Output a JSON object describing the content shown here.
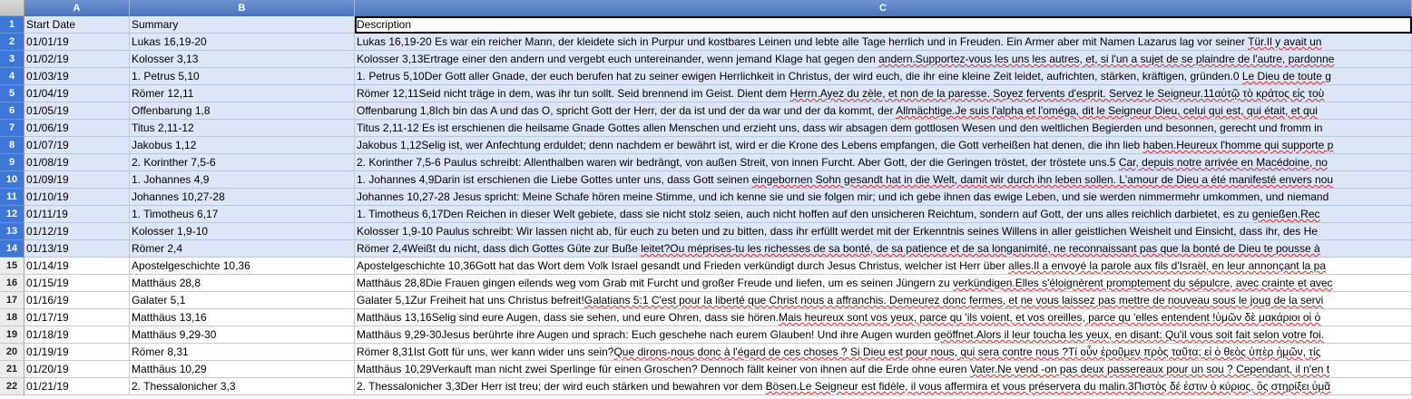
{
  "columns": [
    {
      "letter": "A"
    },
    {
      "letter": "B"
    },
    {
      "letter": "C"
    }
  ],
  "rows": [
    {
      "num": "1",
      "a": "Start Date",
      "b": "Summary",
      "c": "Description",
      "c_extra": ""
    },
    {
      "num": "2",
      "a": "01/01/19",
      "b": "Lukas 16,19-20",
      "c": "Lukas 16,19-20 Es war ein reicher Mann, der kleidete sich in Purpur und kostbares Leinen und lebte alle Tage herrlich und in Freuden. Ein Armer aber mit Namen Lazarus lag vor seiner ",
      "c_extra": "Tür.Il y avait un"
    },
    {
      "num": "3",
      "a": "01/02/19",
      "b": "Kolosser 3,13",
      "c": "Kolosser 3,13Ertrage einer den andern und vergebt euch untereinander, wenn jemand Klage hat gegen den ",
      "c_extra": "andern.Supportez-vous les uns les autres, et, si l'un a sujet de se plaindre de l'autre, pardonne"
    },
    {
      "num": "4",
      "a": "01/03/19",
      "b": "1. Petrus 5,10",
      "c": "1. Petrus 5,10Der Gott aller Gnade, der euch berufen hat zu seiner ewigen Herrlichkeit in Christus, der wird euch, die ihr eine kleine Zeit leidet, aufrichten, stärken, kräftigen, gründen.0 ",
      "c_extra": "Le Dieu de toute g"
    },
    {
      "num": "5",
      "a": "01/04/19",
      "b": "Römer 12,11",
      "c": "Römer 12,11Seid nicht träge in dem, was ihr tun sollt. Seid brennend im Geist. Dient dem ",
      "c_extra": "Herrn.Ayez du zèle, et non de la paresse. Soyez fervents d'esprit. Servez le Seigneur.11αὐτῷ τὸ κράτος εἰς τοὺ"
    },
    {
      "num": "6",
      "a": "01/05/19",
      "b": "Offenbarung 1,8",
      "c": "Offenbarung 1,8Ich bin das A und das O, spricht Gott der Herr, der da ist und der da war und der da kommt, der ",
      "c_extra": "Allmächtige.Je suis l'alpha et l'oméga, dit le Seigneur Dieu, celui qui est, qui était, et qui"
    },
    {
      "num": "7",
      "a": "01/06/19",
      "b": "Titus 2,11-12",
      "c": "Titus 2,11-12 Es ist erschienen die heilsame Gnade Gottes allen Menschen und erzieht uns, dass wir absagen dem gottlosen Wesen und den weltlichen Begierden und besonnen, gerecht und fromm in",
      "c_extra": ""
    },
    {
      "num": "8",
      "a": "01/07/19",
      "b": "Jakobus 1,12",
      "c": "Jakobus 1,12Selig ist, wer Anfechtung erduldet; denn nachdem er bewährt ist, wird er die Krone des Lebens empfangen, die Gott verheißen hat denen, die ihn lieb ",
      "c_extra": "haben.Heureux l'homme qui supporte p"
    },
    {
      "num": "9",
      "a": "01/08/19",
      "b": "2. Korinther 7,5-6",
      "c": "2. Korinther 7,5-6 Paulus schreibt:  Allenthalben waren wir bedrängt, von außen Streit, von innen Furcht. Aber Gott, der die Geringen tröstet, der tröstete uns.5 ",
      "c_extra": "Car, depuis notre arrivée en Macédoine, no"
    },
    {
      "num": "10",
      "a": "01/09/19",
      "b": "1. Johannes 4,9",
      "c": "1. Johannes 4,9Darin ist erschienen die Liebe Gottes unter uns, dass Gott seinen ",
      "c_extra": "eingebornen Sohn gesandt hat in die Welt, damit wir durch ihn leben sollen. L'amour de Dieu a été manifesté envers nou"
    },
    {
      "num": "11",
      "a": "01/10/19",
      "b": "Johannes 10,27-28",
      "c": "Johannes 10,27-28 Jesus spricht:  Meine Schafe hören meine Stimme, und ich kenne sie und sie folgen mir; und ich gebe ihnen das ewige Leben, und sie werden nimmermehr umkommen, und niemand",
      "c_extra": ""
    },
    {
      "num": "12",
      "a": "01/11/19",
      "b": "1. Timotheus 6,17",
      "c": "1. Timotheus 6,17Den Reichen in dieser Welt gebiete, dass sie nicht stolz seien, auch nicht hoffen auf den unsicheren Reichtum, sondern auf Gott, der uns alles reichlich darbietet, es zu ",
      "c_extra": "genießen.Rec"
    },
    {
      "num": "13",
      "a": "01/12/19",
      "b": "Kolosser 1,9-10",
      "c": "Kolosser 1,9-10 Paulus schreibt:  Wir lassen nicht ab, für euch zu beten und zu bitten, dass ihr erfüllt werdet mit der Erkenntnis seines Willens in aller geistlichen Weisheit und Einsicht, dass ihr, des He",
      "c_extra": ""
    },
    {
      "num": "14",
      "a": "01/13/19",
      "b": "Römer 2,4",
      "c": "Römer 2,4Weißt du nicht, dass dich Gottes Güte zur Buße ",
      "c_extra": "leitet?Ou méprises-tu les richesses de sa bonté, de sa patience et de sa longanimité, ne reconnaissant pas que la bonté de Dieu te pousse à"
    },
    {
      "num": "15",
      "a": "01/14/19",
      "b": "Apostelgeschichte 10,36",
      "c": "Apostelgeschichte 10,36Gott hat das Wort dem Volk Israel gesandt und Frieden verkündigt durch Jesus Christus, welcher ist Herr über ",
      "c_extra": "alles.Il a envoyé la parole aux fils d'Israël, en leur annonçant la pa"
    },
    {
      "num": "16",
      "a": "01/15/19",
      "b": "Matthäus 28,8",
      "c": "Matthäus 28,8Die Frauen gingen eilends weg vom Grab mit Furcht und großer Freude und liefen, um es seinen Jüngern zu ",
      "c_extra": "verkündigen.Elles s'éloignèrent promptement du sépulcre, avec crainte et avec"
    },
    {
      "num": "17",
      "a": "01/16/19",
      "b": "Galater 5,1",
      "c": "Galater 5,1Zur Freiheit hat uns Christus befreit!",
      "c_extra": "Galatians 5:1 C'est pour la liberté que Christ nous a affranchis. Demeurez donc fermes, et ne vous laissez pas mettre de nouveau sous le joug de la servi"
    },
    {
      "num": "18",
      "a": "01/17/19",
      "b": "Matthäus 13,16",
      "c": "Matthäus 13,16Selig sind eure Augen, dass sie sehen, und eure Ohren, dass sie hören.",
      "c_extra": "Mais heureux sont vos yeux, parce qu 'ils voient, et vos oreilles, parce qu 'elles entendent !ὑμῶν δὲ μακάριοι οἱ ὀ"
    },
    {
      "num": "19",
      "a": "01/18/19",
      "b": "Matthäus 9,29-30",
      "c": "Matthäus 9,29-30Jesus berührte ihre Augen und sprach: Euch geschehe nach eurem Glauben! Und ihre Augen wurden ",
      "c_extra": "geöffnet.Alors il leur toucha les yeux, en disant: Qu'il vous soit fait selon votre foi."
    },
    {
      "num": "20",
      "a": "01/19/19",
      "b": "Römer 8,31",
      "c": "Römer 8,31Ist Gott für uns, wer kann wider uns sein?",
      "c_extra": "Que dirons-nous donc à l'égard de ces choses ? Si Dieu est pour nous, qui sera contre nous ?Τί οὖν ἐροῦμεν πρὸς ταῦτα; εἰ ὁ θεὸς ὑπὲρ ἡμῶν, τίς"
    },
    {
      "num": "21",
      "a": "01/20/19",
      "b": "Matthäus 10,29",
      "c": "Matthäus 10,29Verkauft man nicht zwei Sperlinge für einen Groschen? Dennoch fällt keiner von ihnen auf die Erde ohne euren ",
      "c_extra": "Vater.Ne vend -on pas deux passereaux pour un sou ? Cependant, il n'en t"
    },
    {
      "num": "22",
      "a": "01/21/19",
      "b": "2. Thessalonicher 3,3",
      "c": "2. Thessalonicher 3,3Der Herr ist treu; der wird euch stärken und bewahren vor dem ",
      "c_extra": "Bösen.Le Seigneur est fidèle, il vous affermira et vous préservera du malin.3Πιστὸς δέ ἐστιν ὁ κύριος, ὃς στηρίξει ὑμᾶ"
    }
  ],
  "selected_rows": [
    "1",
    "2",
    "3",
    "4",
    "5",
    "6",
    "7",
    "8",
    "9",
    "10",
    "11",
    "12",
    "13",
    "14"
  ],
  "active_cell": "C1",
  "colors": {
    "header_blue": "#4a74bd",
    "selected_row_header": "#3d78d8",
    "selected_cell": "#dce6f7",
    "spell_underline": "#d42a2a"
  }
}
